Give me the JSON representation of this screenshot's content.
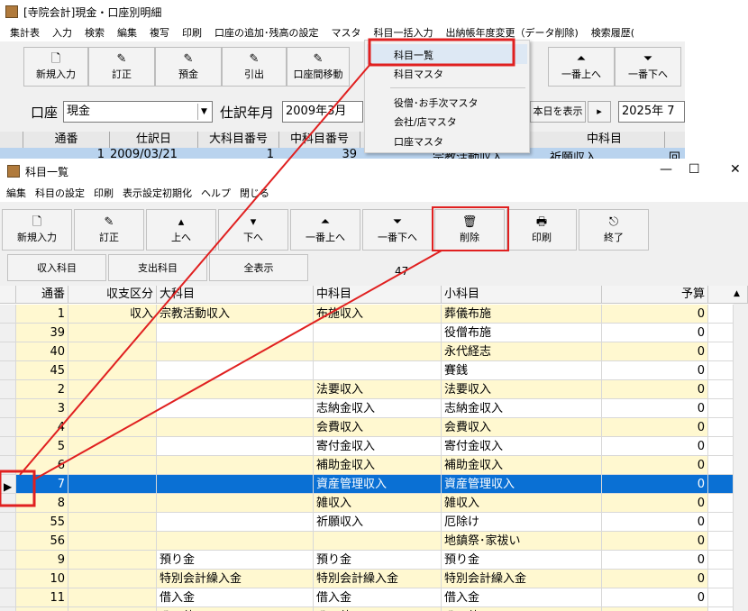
{
  "back_window": {
    "title": "[寺院会計]現金・口座別明細",
    "menu": [
      "集計表",
      "入力",
      "検索",
      "編集",
      "複写",
      "印刷",
      "口座の追加･残高の設定",
      "マスタ",
      "科目一括入力",
      "出納帳年度変更（データ削除)",
      "検索履歴("
    ],
    "toolbar": [
      {
        "label": "新規入力",
        "icon": "new-doc-icon",
        "glyph": "🗋"
      },
      {
        "label": "訂正",
        "icon": "pencil-icon",
        "glyph": "✎"
      },
      {
        "label": "預金",
        "icon": "pencil-icon",
        "glyph": "✎"
      },
      {
        "label": "引出",
        "icon": "pencil-icon",
        "glyph": "✎"
      },
      {
        "label": "口座間移動",
        "icon": "pencil-icon",
        "glyph": "✎"
      },
      {
        "label": "一番上へ",
        "icon": "double-up-icon",
        "glyph": "⏶"
      },
      {
        "label": "一番下へ",
        "icon": "double-down-icon",
        "glyph": "⏷"
      }
    ],
    "account_label": "口座",
    "account_value": "現金",
    "month_label": "仕訳年月",
    "month_value": "2009年3月",
    "today_button": "本日を表示",
    "next_glyph": "▸",
    "year_value": "2025年 7",
    "grid_headers": [
      "通番",
      "仕訳日",
      "大科目番号",
      "中科目番号",
      "中科目"
    ],
    "grid_row": {
      "no": "1",
      "date": "2009/03/21",
      "big": "1",
      "mid": "39",
      "text": "宗教活動収入",
      "mid_name": "祈願収入",
      "extra": "回"
    }
  },
  "popup_menu": {
    "items": [
      "科目一覧",
      "科目マスタ",
      "役僧･お手次マスタ",
      "会社/店マスタ",
      "口座マスタ"
    ],
    "highlighted": "科目一覧"
  },
  "front_window": {
    "title": "科目一覧",
    "controls": {
      "minimize": "—",
      "maximize": "☐",
      "close": "✕"
    },
    "menu": [
      "編集",
      "科目の設定",
      "印刷",
      "表示設定初期化",
      "ヘルプ",
      "閉じる"
    ],
    "toolbar": [
      {
        "label": "新規入力",
        "icon": "new-doc-icon",
        "glyph": "🗋"
      },
      {
        "label": "訂正",
        "icon": "pencil-icon",
        "glyph": "✎"
      },
      {
        "label": "上へ",
        "icon": "up-icon",
        "glyph": "▴"
      },
      {
        "label": "下へ",
        "icon": "down-icon",
        "glyph": "▾"
      },
      {
        "label": "一番上へ",
        "icon": "double-up-icon",
        "glyph": "⏶"
      },
      {
        "label": "一番下へ",
        "icon": "double-down-icon",
        "glyph": "⏷"
      },
      {
        "label": "削除",
        "icon": "trash-icon",
        "glyph": "🗑"
      },
      {
        "label": "印刷",
        "icon": "printer-icon",
        "glyph": "🖶"
      },
      {
        "label": "終了",
        "icon": "exit-icon",
        "glyph": "⎋"
      }
    ],
    "filters": [
      "収入科目",
      "支出科目",
      "全表示"
    ],
    "count": "47",
    "headers": [
      "通番",
      "収支区分",
      "大科目",
      "中科目",
      "小科目",
      "予算"
    ],
    "rows": [
      {
        "no": "1",
        "kbn": "収入",
        "big": "宗教活動収入",
        "mid": "布施収入",
        "small": "葬儀布施",
        "budget": "0"
      },
      {
        "no": "39",
        "kbn": "",
        "big": "",
        "mid": "",
        "small": "役僧布施",
        "budget": "0"
      },
      {
        "no": "40",
        "kbn": "",
        "big": "",
        "mid": "",
        "small": "永代経志",
        "budget": "0"
      },
      {
        "no": "45",
        "kbn": "",
        "big": "",
        "mid": "",
        "small": "賽銭",
        "budget": "0"
      },
      {
        "no": "2",
        "kbn": "",
        "big": "",
        "mid": "法要収入",
        "small": "法要収入",
        "budget": "0"
      },
      {
        "no": "3",
        "kbn": "",
        "big": "",
        "mid": "志納金収入",
        "small": "志納金収入",
        "budget": "0"
      },
      {
        "no": "4",
        "kbn": "",
        "big": "",
        "mid": "会費収入",
        "small": "会費収入",
        "budget": "0"
      },
      {
        "no": "5",
        "kbn": "",
        "big": "",
        "mid": "寄付金収入",
        "small": "寄付金収入",
        "budget": "0"
      },
      {
        "no": "6",
        "kbn": "",
        "big": "",
        "mid": "補助金収入",
        "small": "補助金収入",
        "budget": "0"
      },
      {
        "no": "7",
        "kbn": "",
        "big": "",
        "mid": "資産管理収入",
        "small": "資産管理収入",
        "budget": "0",
        "selected": true
      },
      {
        "no": "8",
        "kbn": "",
        "big": "",
        "mid": "雑収入",
        "small": "雑収入",
        "budget": "0"
      },
      {
        "no": "55",
        "kbn": "",
        "big": "",
        "mid": "祈願収入",
        "small": "厄除け",
        "budget": "0"
      },
      {
        "no": "56",
        "kbn": "",
        "big": "",
        "mid": "",
        "small": "地鎮祭･家祓い",
        "budget": "0"
      },
      {
        "no": "9",
        "kbn": "",
        "big": "預り金",
        "mid": "預り金",
        "small": "預り金",
        "budget": "0"
      },
      {
        "no": "10",
        "kbn": "",
        "big": "特別会計繰入金",
        "mid": "特別会計繰入金",
        "small": "特別会計繰入金",
        "budget": "0"
      },
      {
        "no": "11",
        "kbn": "",
        "big": "借入金",
        "mid": "借入金",
        "small": "借入金",
        "budget": "0"
      },
      {
        "no": "",
        "kbn": "",
        "big": "その他",
        "mid": "その他",
        "small": "その他",
        "budget": ""
      }
    ],
    "current_row_marker": "▶"
  },
  "annotation_color": "#e02020"
}
